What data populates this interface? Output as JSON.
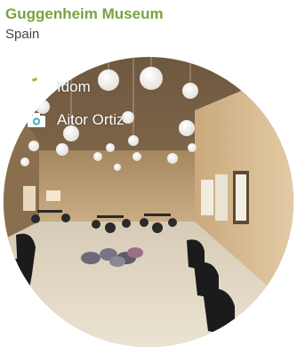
{
  "title": "Guggenheim Museum",
  "subtitle": "Spain",
  "credits": {
    "architect": {
      "icon": "pencil-icon",
      "name": "Idom"
    },
    "photographer": {
      "icon": "camera-icon",
      "name": "Aitor Ortiz"
    }
  },
  "colors": {
    "title": "#7aa33d",
    "subtitle": "#444444",
    "credit_text": "#ffffff"
  }
}
